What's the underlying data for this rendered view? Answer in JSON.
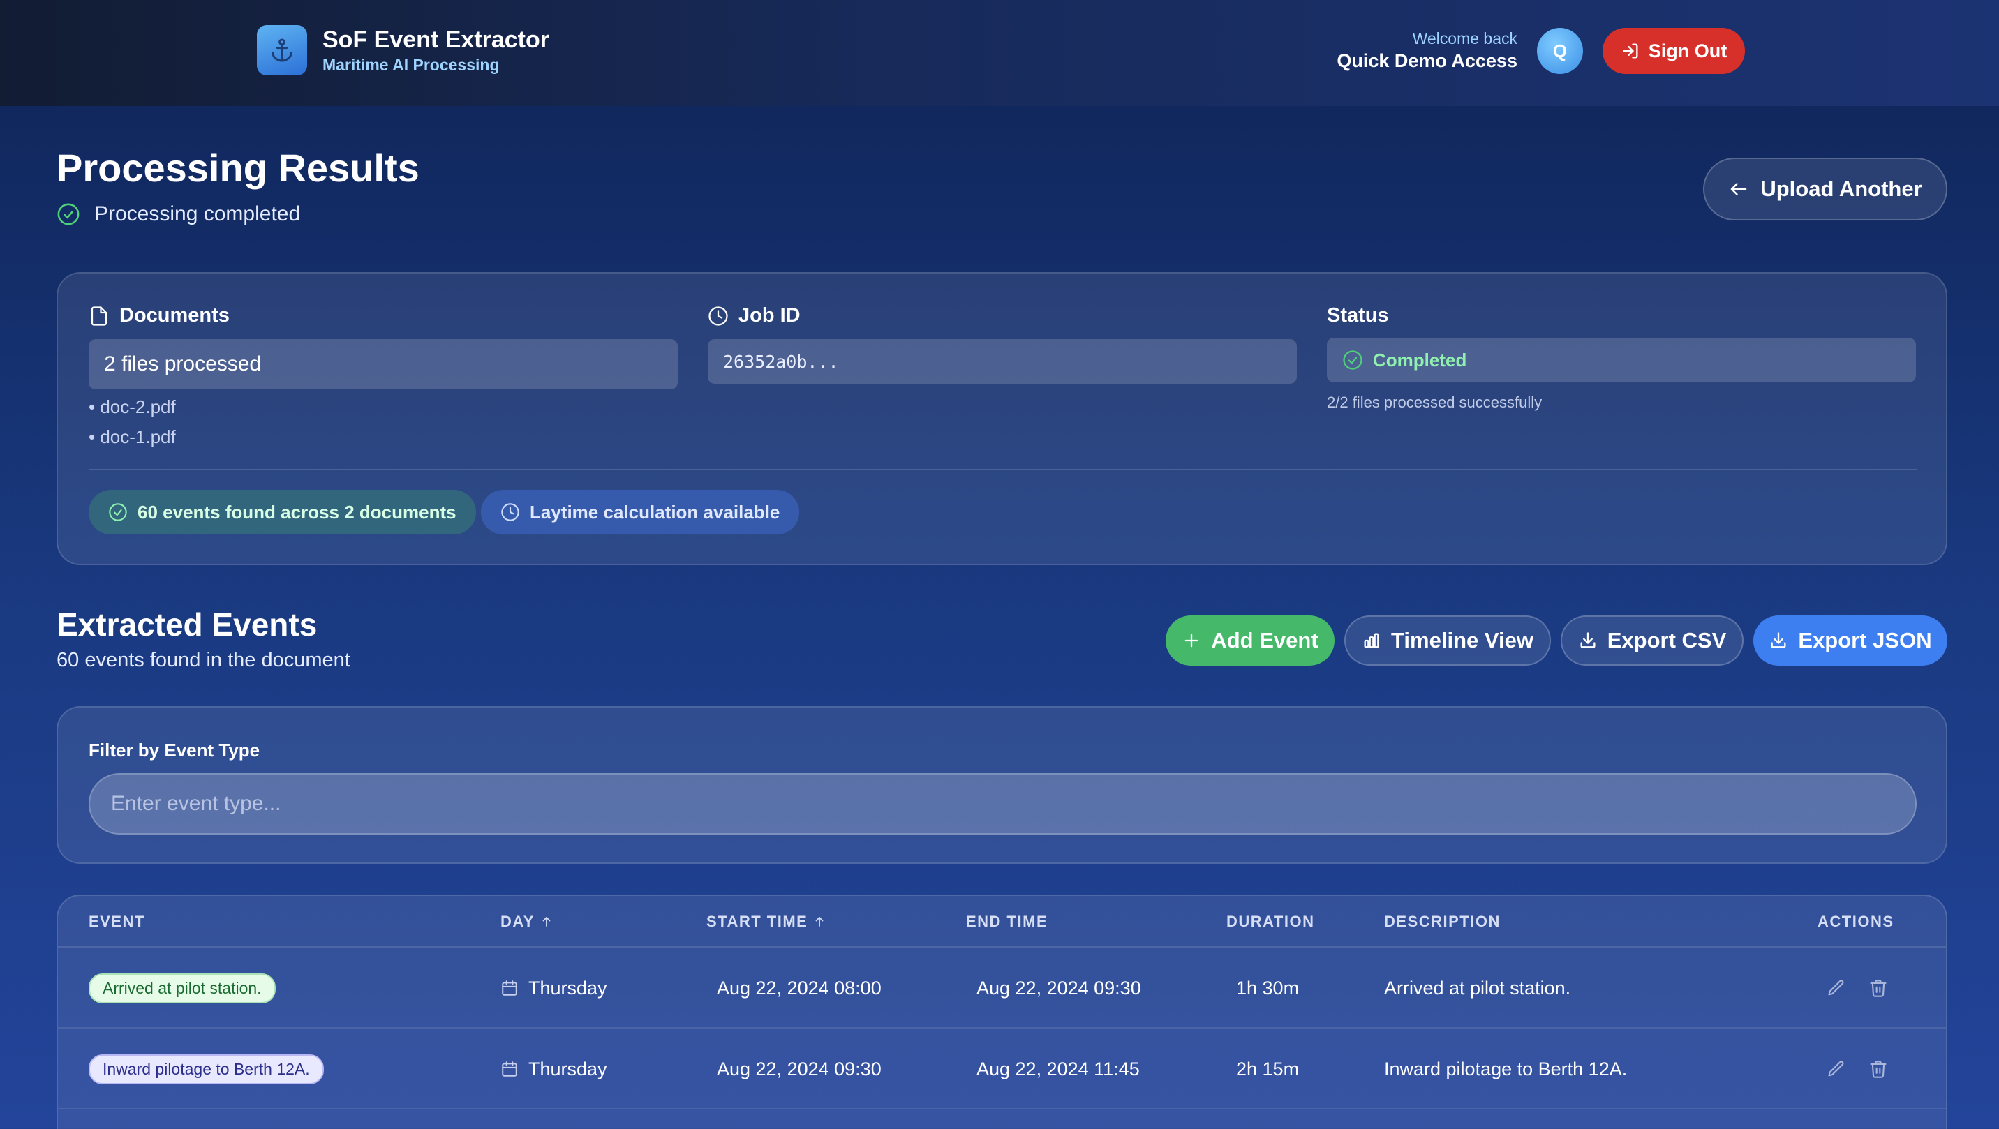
{
  "header": {
    "app_title": "SoF Event Extractor",
    "app_subtitle": "Maritime AI Processing",
    "welcome_label": "Welcome back",
    "user_name": "Quick Demo Access",
    "avatar_initial": "Q",
    "sign_out_label": "Sign Out"
  },
  "results": {
    "title": "Processing Results",
    "status_text": "Processing completed",
    "upload_label": "Upload Another"
  },
  "summary": {
    "documents_label": "Documents",
    "documents_value": "2 files processed",
    "files": [
      "• doc-2.pdf",
      "• doc-1.pdf"
    ],
    "job_label": "Job ID",
    "job_value": "26352a0b...",
    "status_label": "Status",
    "status_value": "Completed",
    "status_detail": "2/2 files processed successfully",
    "events_pill": "60 events found across 2 documents",
    "laytime_pill": "Laytime calculation available"
  },
  "events_section": {
    "title": "Extracted Events",
    "subtitle": "60 events found in the document",
    "add_label": "Add Event",
    "timeline_label": "Timeline View",
    "csv_label": "Export CSV",
    "json_label": "Export JSON"
  },
  "filter": {
    "label": "Filter by Event Type",
    "placeholder": "Enter event type...",
    "value": ""
  },
  "table": {
    "columns": {
      "event": "EVENT",
      "day": "DAY",
      "start": "START TIME",
      "end": "END TIME",
      "duration": "DURATION",
      "description": "DESCRIPTION",
      "actions": "ACTIONS"
    },
    "rows": [
      {
        "event": "Arrived at pilot station.",
        "day": "Thursday",
        "start": "Aug 22, 2024 08:00",
        "end": "Aug 22, 2024 09:30",
        "duration": "1h 30m",
        "description": "Arrived at pilot station."
      },
      {
        "event": "Inward pilotage to Berth 12A.",
        "day": "Thursday",
        "start": "Aug 22, 2024 09:30",
        "end": "Aug 22, 2024 11:45",
        "duration": "2h 15m",
        "description": "Inward pilotage to Berth 12A."
      }
    ]
  },
  "colors": {
    "accent_blue": "#3d7ff0",
    "success_green": "#45b86a",
    "danger_red": "#d7302a"
  },
  "icons": [
    "anchor-icon",
    "sign-out-icon",
    "check-circle-icon",
    "arrow-left-icon",
    "file-icon",
    "clock-icon",
    "plus-icon",
    "bar-chart-icon",
    "download-icon",
    "sort-arrow-icon",
    "calendar-icon",
    "edit-icon",
    "trash-icon"
  ]
}
